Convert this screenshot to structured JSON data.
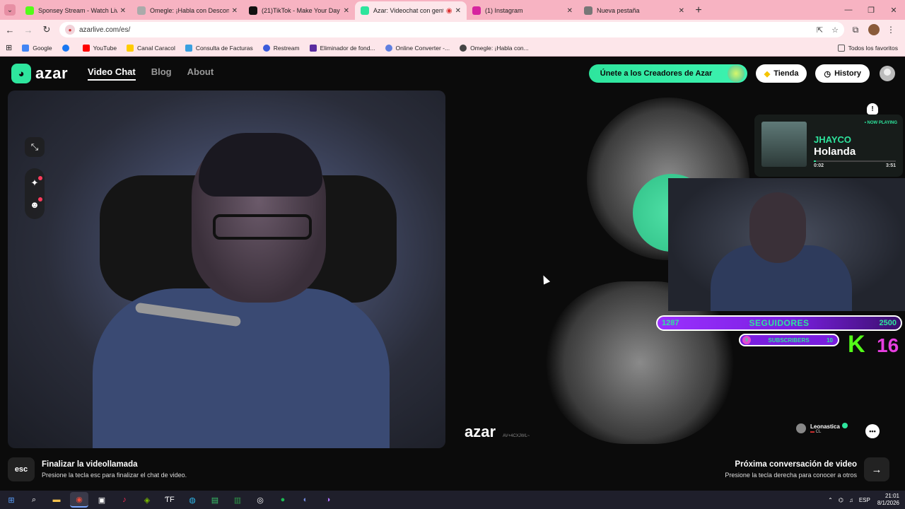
{
  "browser": {
    "tabs": [
      {
        "title": "Sponsey Stream - Watch Live o",
        "fav_color": "#53fc18",
        "active": false
      },
      {
        "title": "Omegle: ¡Habla con Desconoc",
        "fav_color": "#aaaaaa",
        "active": false
      },
      {
        "title": "(21)TikTok - Make Your Day",
        "fav_color": "#111111",
        "active": false
      },
      {
        "title": "Azar: Videochat con gente",
        "fav_color": "#2ee59d",
        "active": true
      },
      {
        "title": "(1) Instagram",
        "fav_color": "#d6249f",
        "active": false
      },
      {
        "title": "Nueva pestaña",
        "fav_color": "#777777",
        "active": false
      }
    ],
    "url": "azarlive.com/es/",
    "bookmarks": [
      {
        "label": "Google",
        "color": "#4285f4"
      },
      {
        "label": "",
        "color": "#1877f2"
      },
      {
        "label": "YouTube",
        "color": "#ff0000"
      },
      {
        "label": "Canal Caracol",
        "color": "#ffcc00"
      },
      {
        "label": "Consulta de Facturas",
        "color": "#3aa0e0"
      },
      {
        "label": "Restream",
        "color": "#3b5bdb"
      },
      {
        "label": "Eliminador de fond...",
        "color": "#5a2ca0"
      },
      {
        "label": "Online Converter -...",
        "color": "#5f7fe0"
      },
      {
        "label": "Omegle: ¡Habla con...",
        "color": "#444444"
      }
    ],
    "all_bookmarks": "Todos los favoritos"
  },
  "header": {
    "logo_text": "azar",
    "nav": [
      {
        "label": "Video Chat",
        "active": true
      },
      {
        "label": "Blog",
        "active": false
      },
      {
        "label": "About",
        "active": false
      }
    ],
    "creators_label": "Únete a los Creadores de Azar",
    "shop_label": "Tienda",
    "history_label": "History"
  },
  "remote": {
    "watermark": "azar",
    "code": "AV+4CXJWL~",
    "partner_name": "Leonastica",
    "partner_country": "CL"
  },
  "now_playing": {
    "tag": "• NOW PLAYING",
    "artist": "JHAYCO",
    "song": "Holanda",
    "elapsed": "0:02",
    "duration": "3:51",
    "progress": 0.01
  },
  "goals": {
    "followers_current": "1287",
    "followers_label": "SEGUIDORES",
    "followers_goal": "2500",
    "subs_current": "9",
    "subs_label": "SUBSCRIBERS",
    "subs_goal": "10",
    "kick_letter": "K",
    "kick_count": "16"
  },
  "bottom": {
    "esc_key": "esc",
    "end_title": "Finalizar la videollamada",
    "end_sub": "Presione la tecla esc para finalizar el chat de video.",
    "next_title": "Próxima conversación de video",
    "next_sub": "Presione la tecla derecha para conocer a otros"
  },
  "taskbar": {
    "lang": "ESP",
    "time": "21:01",
    "date": "8/1/2026"
  },
  "colors": {
    "accent": "#2ee59d",
    "tabbar": "#f7b3c2",
    "kick_green": "#53fc18",
    "purple": "#7a1fe0"
  }
}
